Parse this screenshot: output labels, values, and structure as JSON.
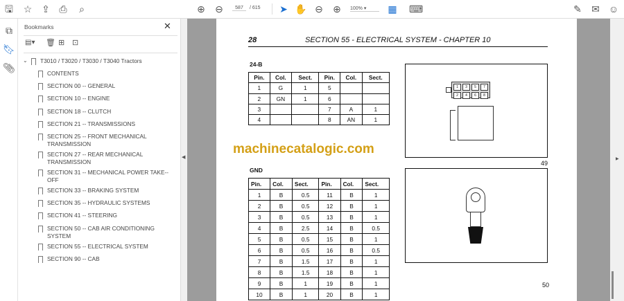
{
  "toolbar": {
    "page_current": "587",
    "page_total": "/ 615",
    "zoom": "100%"
  },
  "bookmarks": {
    "title": "Bookmarks",
    "root": "T3010 / T3020 / T3030 / T3040 Tractors",
    "items": [
      "CONTENTS",
      "SECTION 00 -- GENERAL",
      "SECTION 10 -- ENGINE",
      "SECTION 18 -- CLUTCH",
      "SECTION 21 -- TRANSMISSIONS",
      "SECTION 25 -- FRONT MECHANICAL TRANSMISSION",
      "SECTION 27 -- REAR MECHANICAL TRANSMISSION",
      "SECTION 31 -- MECHANICAL POWER TAKE--OFF",
      "SECTION 33 -- BRAKING SYSTEM",
      "SECTION 35 -- HYDRAULIC SYSTEMS",
      "SECTION 41 -- STEERING",
      "SECTION 50 -- CAB AIR CONDITIONING SYSTEM",
      "SECTION 55 -- ELECTRICAL SYSTEM",
      "SECTION 90 -- CAB"
    ]
  },
  "page": {
    "number": "28",
    "title": "SECTION 55 - ELECTRICAL SYSTEM - CHAPTER 10",
    "watermark": "machinecatalogic.com",
    "table1": {
      "label": "24-B",
      "headers": [
        "Pin.",
        "Col.",
        "Sect.",
        "Pin.",
        "Col.",
        "Sect."
      ],
      "rows": [
        [
          "1",
          "G",
          "1",
          "5",
          "",
          ""
        ],
        [
          "2",
          "GN",
          "1",
          "6",
          "",
          ""
        ],
        [
          "3",
          "",
          "",
          "7",
          "A",
          "1"
        ],
        [
          "4",
          "",
          "",
          "8",
          "AN",
          "1"
        ]
      ]
    },
    "figure1": {
      "pins": [
        "1",
        "3",
        "5",
        "7",
        "2",
        "4",
        "6",
        "8"
      ],
      "number": "49"
    },
    "table2": {
      "label": "GND",
      "headers": [
        "Pin.",
        "Col.",
        "Sect.",
        "Pin.",
        "Col.",
        "Sect."
      ],
      "rows": [
        [
          "1",
          "B",
          "0.5",
          "11",
          "B",
          "1"
        ],
        [
          "2",
          "B",
          "0.5",
          "12",
          "B",
          "1"
        ],
        [
          "3",
          "B",
          "0.5",
          "13",
          "B",
          "1"
        ],
        [
          "4",
          "B",
          "2.5",
          "14",
          "B",
          "0.5"
        ],
        [
          "5",
          "B",
          "0.5",
          "15",
          "B",
          "1"
        ],
        [
          "6",
          "B",
          "0.5",
          "16",
          "B",
          "0.5"
        ],
        [
          "7",
          "B",
          "1.5",
          "17",
          "B",
          "1"
        ],
        [
          "8",
          "B",
          "1.5",
          "18",
          "B",
          "1"
        ],
        [
          "9",
          "B",
          "1",
          "19",
          "B",
          "1"
        ],
        [
          "10",
          "B",
          "1",
          "20",
          "B",
          "1"
        ]
      ]
    },
    "figure2": {
      "number": "50"
    }
  }
}
